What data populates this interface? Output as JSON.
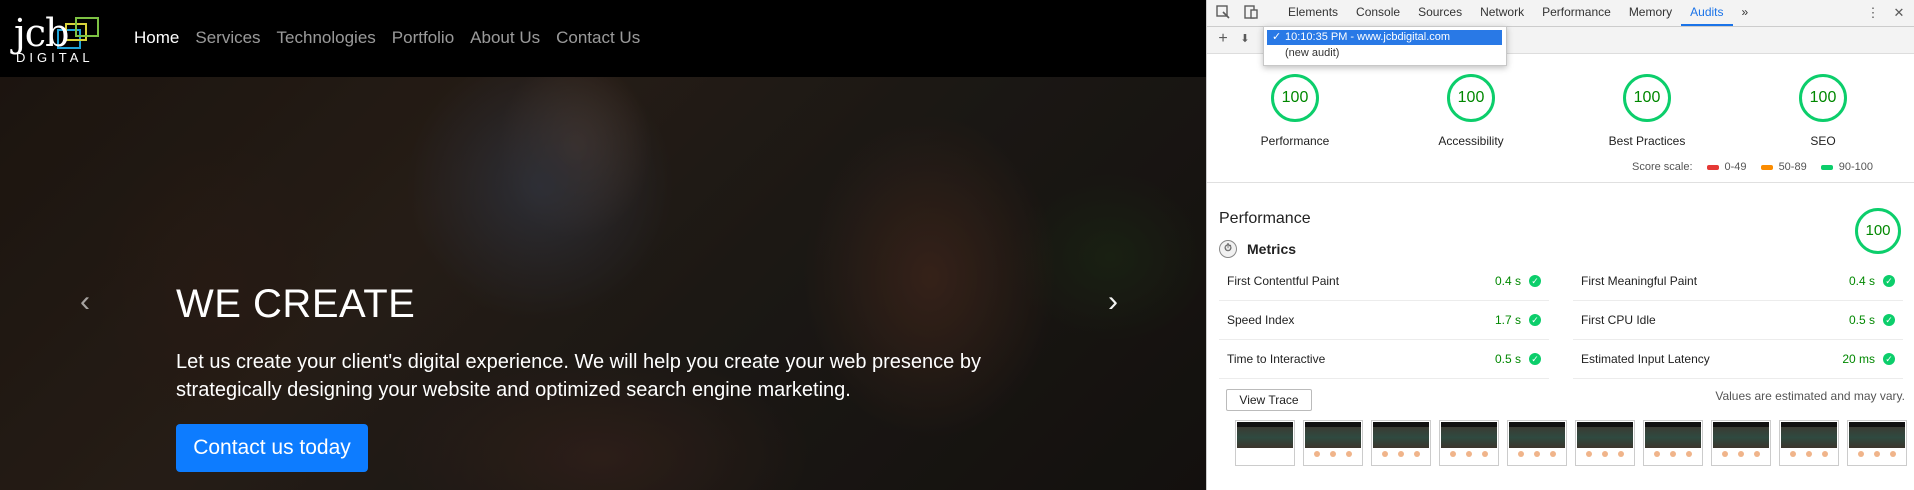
{
  "site": {
    "logo": {
      "main": "jcb",
      "sub": "DIGITAL"
    },
    "nav": [
      "Home",
      "Services",
      "Technologies",
      "Portfolio",
      "About Us",
      "Contact Us"
    ],
    "hero": {
      "title": "WE CREATE",
      "text": "Let us create your client's digital experience. We will help you create your web presence by strategically designing your website and optimized search engine marketing.",
      "button": "Contact us today",
      "prev_icon": "‹",
      "next_icon": "›"
    },
    "colors": {
      "nav_bg": "#000000",
      "button": "#0d7cff"
    }
  },
  "devtools": {
    "tabs": [
      "Elements",
      "Console",
      "Sources",
      "Network",
      "Performance",
      "Memory",
      "Audits"
    ],
    "active_tab": "Audits",
    "more_tabs": "»",
    "menu_icon": "⋮",
    "close_icon": "✕",
    "toolbar": {
      "add_icon": "+",
      "download_icon": "⬇"
    },
    "audit_dropdown": {
      "options": [
        "10:10:35 PM - www.jcbdigital.com",
        "(new audit)"
      ],
      "selected": "10:10:35 PM - www.jcbdigital.com"
    },
    "gauges": [
      {
        "label": "Performance",
        "score": "100"
      },
      {
        "label": "Accessibility",
        "score": "100"
      },
      {
        "label": "Best Practices",
        "score": "100"
      },
      {
        "label": "SEO",
        "score": "100"
      }
    ],
    "score_scale": {
      "label": "Score scale:",
      "ranges": [
        {
          "label": "0-49",
          "color": "#e53935"
        },
        {
          "label": "50-89",
          "color": "#fb8c00"
        },
        {
          "label": "90-100",
          "color": "#0cce6b"
        }
      ]
    },
    "performance": {
      "title": "Performance",
      "score": "100",
      "metrics_title": "Metrics",
      "metrics": [
        {
          "name": "First Contentful Paint",
          "value": "0.4 s"
        },
        {
          "name": "First Meaningful Paint",
          "value": "0.4 s"
        },
        {
          "name": "Speed Index",
          "value": "1.7 s"
        },
        {
          "name": "First CPU Idle",
          "value": "0.5 s"
        },
        {
          "name": "Time to Interactive",
          "value": "0.5 s"
        },
        {
          "name": "Estimated Input Latency",
          "value": "20 ms"
        }
      ],
      "view_trace": "View Trace",
      "note": "Values are estimated and may vary.",
      "filmstrip_frames": 10
    }
  }
}
